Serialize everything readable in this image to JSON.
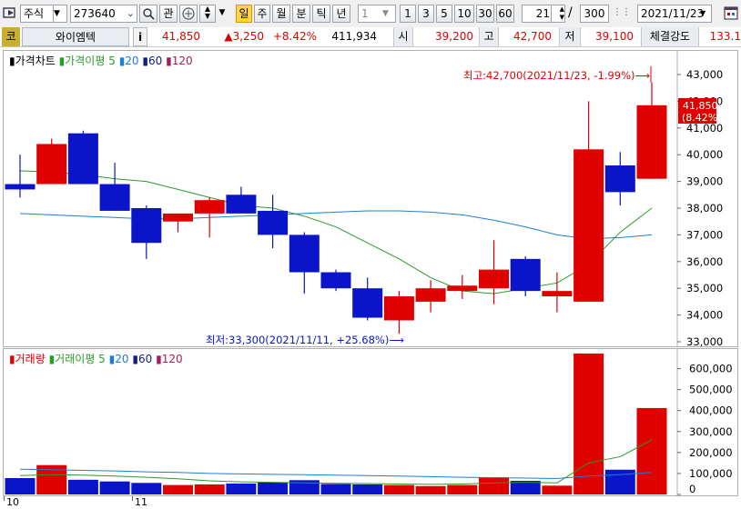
{
  "toolbar": {
    "market_select": "주식",
    "stock_code": "273640",
    "gwan_label": "관",
    "period_buttons": [
      "일",
      "주",
      "월",
      "분",
      "틱",
      "년"
    ],
    "interval_value": "1",
    "interval_buttons": [
      "1",
      "3",
      "5",
      "10",
      "30",
      "60"
    ],
    "count_value": "21",
    "count_total": "300",
    "count_sep": "/",
    "date_value": "2021/11/23"
  },
  "info": {
    "market_code": "코",
    "stock_name": "와이엠텍",
    "info_icon": "i",
    "price": "41,850",
    "change": "▲3,250",
    "change_pct": "+8.42%",
    "volume": "411,934",
    "open_label": "시",
    "open": "39,200",
    "high_label": "고",
    "high": "42,700",
    "low_label": "저",
    "low": "39,100",
    "strength_label": "체결강도",
    "strength": "133.1"
  },
  "price_panel": {
    "legend": {
      "main": "가격차트",
      "ma": "가격이평",
      "periods": [
        "5",
        "20",
        "60",
        "120"
      ]
    },
    "high_note": "최고:42,700(2021/11/23, -1.99%)⟶",
    "low_note": "최저:33,300(2021/11/11, +25.68%)⟶",
    "current_tag": [
      "41,850",
      "(8.42%)"
    ],
    "axis_labels": [
      "43,000",
      "42,000",
      "41,000",
      "40,000",
      "39,000",
      "38,000",
      "37,000",
      "36,000",
      "35,000",
      "34,000",
      "33,000"
    ]
  },
  "volume_panel": {
    "legend": {
      "main": "거래량",
      "ma": "거래이평",
      "periods": [
        "5",
        "20",
        "60",
        "120"
      ]
    },
    "axis_labels": [
      "600,000",
      "500,000",
      "400,000",
      "300,000",
      "200,000",
      "100,000",
      "0"
    ]
  },
  "x_axis": {
    "labels": [
      "10",
      "11"
    ]
  },
  "chart_data": {
    "type": "candlestick",
    "up_color": "#e00000",
    "down_color": "#0a14c8",
    "price_ylim": [
      33000,
      43000
    ],
    "volume_ylim": [
      0,
      650000
    ],
    "candles": [
      {
        "o": 38900,
        "h": 40000,
        "l": 38400,
        "c": 38700
      },
      {
        "o": 38900,
        "h": 40600,
        "l": 38900,
        "c": 40400
      },
      {
        "o": 40800,
        "h": 40900,
        "l": 38900,
        "c": 38900
      },
      {
        "o": 38900,
        "h": 39700,
        "l": 37900,
        "c": 37900
      },
      {
        "o": 38000,
        "h": 38100,
        "l": 36100,
        "c": 36700
      },
      {
        "o": 37500,
        "h": 37700,
        "l": 37100,
        "c": 37800
      },
      {
        "o": 37800,
        "h": 38400,
        "l": 36900,
        "c": 38300
      },
      {
        "o": 38500,
        "h": 38800,
        "l": 37800,
        "c": 37800
      },
      {
        "o": 37900,
        "h": 38500,
        "l": 36500,
        "c": 37000
      },
      {
        "o": 37000,
        "h": 37100,
        "l": 34800,
        "c": 35600
      },
      {
        "o": 35600,
        "h": 35700,
        "l": 34900,
        "c": 35000
      },
      {
        "o": 35000,
        "h": 35400,
        "l": 33800,
        "c": 33900
      },
      {
        "o": 33800,
        "h": 34900,
        "l": 33300,
        "c": 34700
      },
      {
        "o": 34500,
        "h": 35300,
        "l": 34100,
        "c": 35000
      },
      {
        "o": 34900,
        "h": 35500,
        "l": 34600,
        "c": 35100
      },
      {
        "o": 35000,
        "h": 36800,
        "l": 34400,
        "c": 35700
      },
      {
        "o": 36100,
        "h": 36200,
        "l": 34700,
        "c": 34900
      },
      {
        "o": 34700,
        "h": 35600,
        "l": 34100,
        "c": 34900
      },
      {
        "o": 34500,
        "h": 42000,
        "l": 34500,
        "c": 40200
      },
      {
        "o": 39600,
        "h": 40100,
        "l": 38100,
        "c": 38600
      },
      {
        "o": 39100,
        "h": 42700,
        "l": 39100,
        "c": 41850
      }
    ],
    "volumes": [
      78000,
      140000,
      70000,
      62000,
      55000,
      45000,
      48000,
      52000,
      58000,
      68000,
      50000,
      48000,
      45000,
      40000,
      45000,
      82000,
      65000,
      42000,
      672000,
      118000,
      411934
    ],
    "ma5_price": [
      39400,
      39350,
      39250,
      39100,
      39000,
      38700,
      38400,
      38100,
      38000,
      37700,
      37300,
      36700,
      36100,
      35400,
      34900,
      34800,
      35000,
      35200,
      35900,
      37100,
      38000
    ],
    "ma20_price": [
      37800,
      37750,
      37700,
      37650,
      37600,
      37600,
      37650,
      37700,
      37750,
      37800,
      37850,
      37900,
      37900,
      37850,
      37750,
      37550,
      37300,
      37000,
      36850,
      36900,
      37000
    ],
    "ma5_vol": [
      90000,
      95000,
      92000,
      88000,
      82000,
      75000,
      65000,
      60000,
      58000,
      55000,
      53000,
      52000,
      50000,
      48000,
      50000,
      55000,
      58000,
      55000,
      150000,
      180000,
      260000
    ],
    "ma20_vol": [
      120000,
      118000,
      115000,
      112000,
      108000,
      105000,
      100000,
      98000,
      96000,
      94000,
      92000,
      90000,
      88000,
      85000,
      82000,
      80000,
      78000,
      76000,
      88000,
      95000,
      105000
    ]
  }
}
